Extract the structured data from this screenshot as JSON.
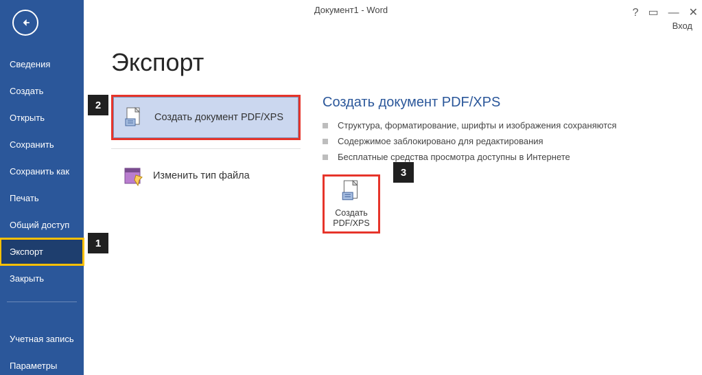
{
  "window": {
    "title": "Документ1 - Word",
    "login": "Вход"
  },
  "sidebar": {
    "items": [
      {
        "label": "Сведения"
      },
      {
        "label": "Создать"
      },
      {
        "label": "Открыть"
      },
      {
        "label": "Сохранить"
      },
      {
        "label": "Сохранить как"
      },
      {
        "label": "Печать"
      },
      {
        "label": "Общий доступ"
      },
      {
        "label": "Экспорт"
      },
      {
        "label": "Закрыть"
      }
    ],
    "footer": [
      {
        "label": "Учетная запись"
      },
      {
        "label": "Параметры"
      }
    ]
  },
  "page": {
    "title": "Экспорт",
    "options": [
      {
        "label": "Создать документ PDF/XPS"
      },
      {
        "label": "Изменить тип файла"
      }
    ],
    "details": {
      "heading": "Создать документ PDF/XPS",
      "bullets": [
        "Структура, форматирование, шрифты и изображения сохраняются",
        "Содержимое заблокировано для редактирования",
        "Бесплатные средства просмотра доступны в Интернете"
      ],
      "button_line1": "Создать",
      "button_line2": "PDF/XPS"
    }
  },
  "callouts": {
    "c1": "1",
    "c2": "2",
    "c3": "3"
  }
}
